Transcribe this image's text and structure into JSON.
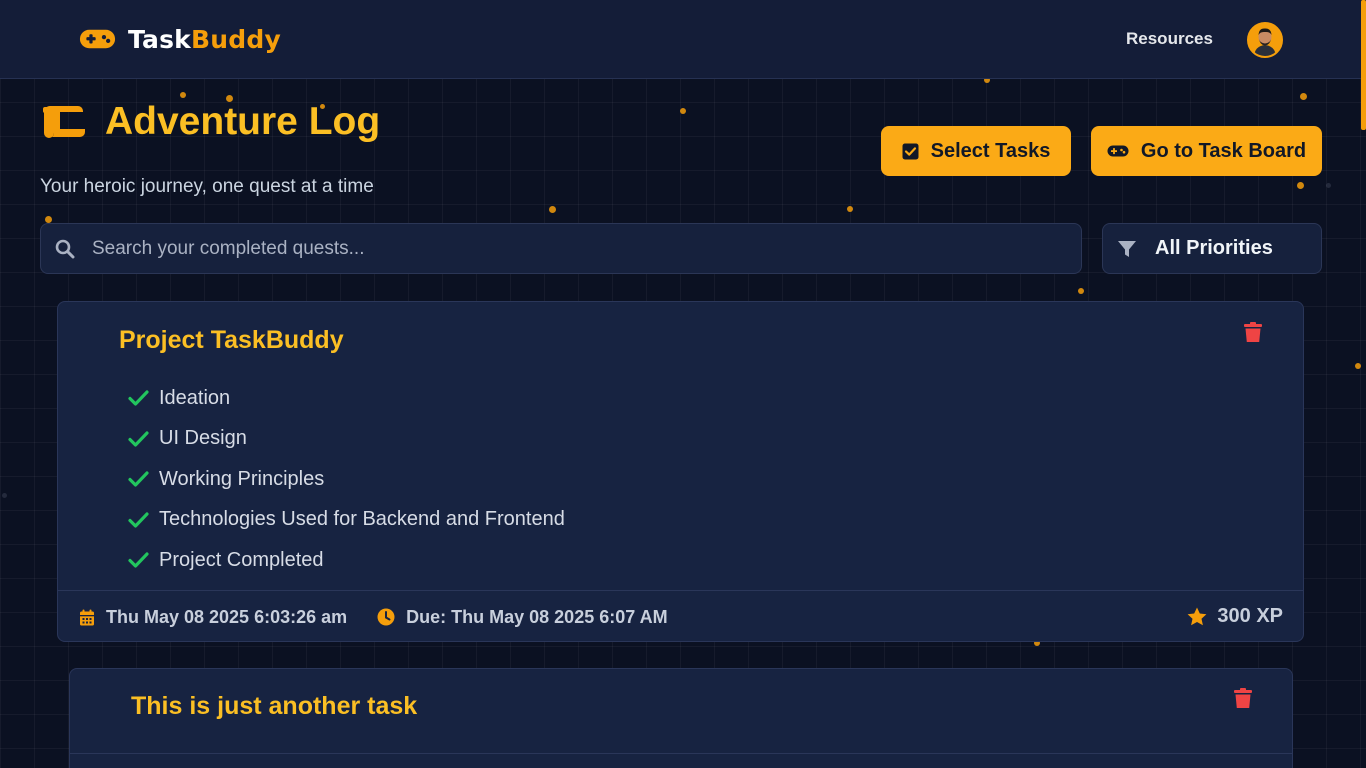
{
  "brand": {
    "name_part1": "Task",
    "name_part2": "Buddy"
  },
  "nav": {
    "resources_label": "Resources"
  },
  "page": {
    "title": "Adventure Log",
    "subtitle": "Your heroic journey, one quest at a time"
  },
  "actions": {
    "select_tasks_label": "Select Tasks",
    "task_board_label": "Go to Task Board"
  },
  "search": {
    "placeholder": "Search your completed quests...",
    "value": ""
  },
  "filter": {
    "selected": "All Priorities"
  },
  "tasks": [
    {
      "title": "Project TaskBuddy",
      "subtasks": [
        "Ideation",
        "UI Design",
        "Working Principles",
        "Technologies Used for Backend and Frontend",
        "Project Completed"
      ],
      "completed_at": "Thu May 08 2025 6:03:26 am",
      "due": "Due: Thu May 08 2025 6:07 AM",
      "xp": "300 XP"
    },
    {
      "title": "This is just another task"
    }
  ],
  "colors": {
    "accent": "#f59e0b",
    "title": "#fbbf24",
    "check": "#22c55e",
    "trash": "#ef4444",
    "background": "#0b1122",
    "card": "#172341"
  }
}
